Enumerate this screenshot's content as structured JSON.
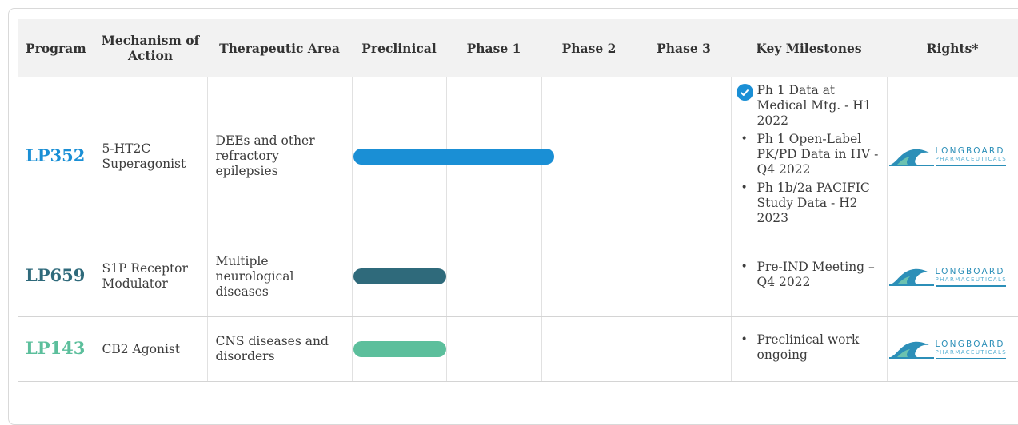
{
  "headers": {
    "program": "Program",
    "mechanism": "Mechanism of Action",
    "area": "Therapeutic Area",
    "preclinical": "Preclinical",
    "phase1": "Phase 1",
    "phase2": "Phase 2",
    "phase3": "Phase 3",
    "milestones": "Key Milestones",
    "rights": "Rights*"
  },
  "colors": {
    "lp352": "#1a8fd5",
    "lp659": "#2f6a7b",
    "lp143": "#5cbf9c",
    "logo": "#2c8fb8"
  },
  "logo": {
    "name": "LONGBOARD",
    "sub": "PHARMACEUTICALS"
  },
  "rows": [
    {
      "program": "LP352",
      "mechanism": "5-HT2C Superagonist",
      "area": "DEEs and other refractory epilepsies",
      "progress_phases": 2.15,
      "milestones": [
        {
          "text": "Ph 1 Data at Medical Mtg. - H1 2022",
          "icon": "check-circle-icon"
        },
        {
          "text": "Ph 1 Open-Label PK/PD Data in HV - Q4 2022",
          "icon": "bullet"
        },
        {
          "text": "Ph 1b/2a PACIFIC Study Data -  H2 2023",
          "icon": "bullet"
        }
      ]
    },
    {
      "program": "LP659",
      "mechanism": "S1P Receptor Modulator",
      "area": "Multiple neurological diseases",
      "progress_phases": 1.0,
      "milestones": [
        {
          "text": "Pre-IND Meeting – Q4 2022",
          "icon": "bullet"
        }
      ]
    },
    {
      "program": "LP143",
      "mechanism": "CB2 Agonist",
      "area": "CNS diseases and disorders",
      "progress_phases": 1.0,
      "milestones": [
        {
          "text": "Preclinical work ongoing",
          "icon": "bullet"
        }
      ]
    }
  ]
}
